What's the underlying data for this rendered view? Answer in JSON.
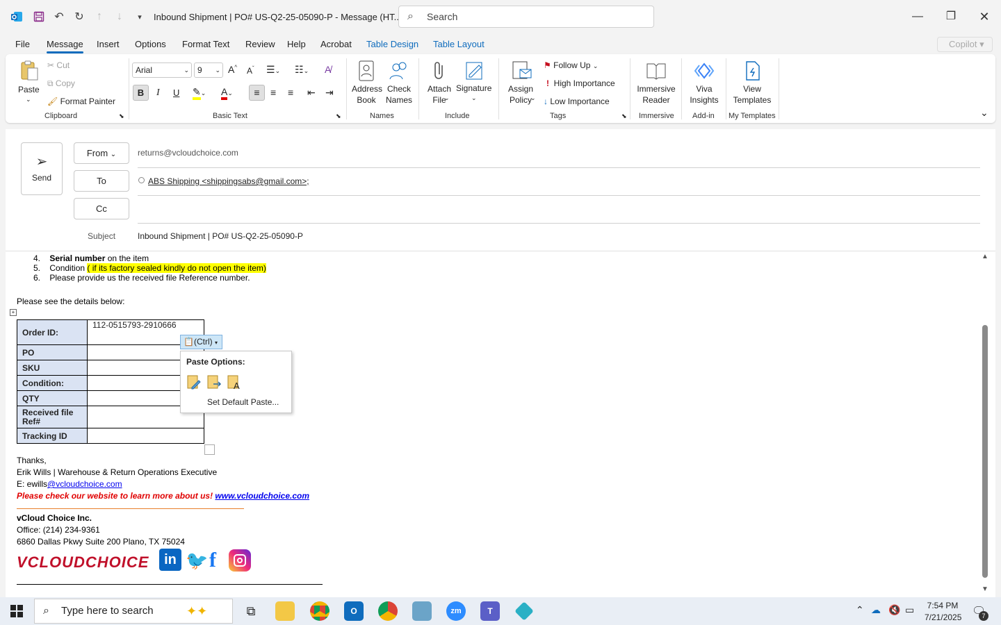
{
  "window": {
    "title": "Inbound Shipment | PO# US-Q2-25-05090-P  -  Message (HT...",
    "search_placeholder": "Search"
  },
  "tabs": [
    {
      "label": "File"
    },
    {
      "label": "Message"
    },
    {
      "label": "Insert"
    },
    {
      "label": "Options"
    },
    {
      "label": "Format Text"
    },
    {
      "label": "Review"
    },
    {
      "label": "Help"
    },
    {
      "label": "Acrobat"
    },
    {
      "label": "Table Design"
    },
    {
      "label": "Table Layout"
    }
  ],
  "copilot_label": "Copilot",
  "ribbon": {
    "clipboard": {
      "paste": "Paste",
      "cut": "Cut",
      "copy": "Copy",
      "format_painter": "Format Painter",
      "group": "Clipboard"
    },
    "basic_text": {
      "font": "Arial",
      "size": "9",
      "group": "Basic Text"
    },
    "names": {
      "address_book": "Address Book",
      "check_names": "Check Names",
      "group": "Names"
    },
    "include": {
      "attach_file": "Attach File",
      "signature": "Signature",
      "group": "Include"
    },
    "tags": {
      "assign_policy": "Assign Policy",
      "follow_up": "Follow Up",
      "high_importance": "High Importance",
      "low_importance": "Low Importance",
      "group": "Tags"
    },
    "immersive": {
      "reader": "Immersive Reader",
      "group": "Immersive"
    },
    "addin": {
      "viva": "Viva Insights",
      "group": "Add-in"
    },
    "templates": {
      "view": "View Templates",
      "group": "My Templates"
    }
  },
  "compose": {
    "send": "Send",
    "from_label": "From",
    "from_value": "returns@vcloudchoice.com",
    "to_label": "To",
    "to_value": "ABS Shipping <shippingsabs@gmail.com>;",
    "cc_label": "Cc",
    "subject_label": "Subject",
    "subject_value": "Inbound Shipment | PO# US-Q2-25-05090-P"
  },
  "body": {
    "list": [
      {
        "num": "4.",
        "bold": "Serial number",
        "rest": " on the item"
      },
      {
        "num": "5.",
        "text": "Condition ",
        "highlight": "( if its factory sealed kindly do not open the item)"
      },
      {
        "num": "6.",
        "text": "Please provide us the received file Reference number."
      }
    ],
    "intro": "Please see the details below:",
    "table": [
      {
        "label": "Order ID:",
        "value": "112-0515793-2910666"
      },
      {
        "label": "PO",
        "value": ""
      },
      {
        "label": "SKU",
        "value": ""
      },
      {
        "label": "Condition:",
        "value": ""
      },
      {
        "label": "QTY",
        "value": ""
      },
      {
        "label": "Received file Ref#",
        "value": ""
      },
      {
        "label": "Tracking ID",
        "value": ""
      }
    ],
    "thanks": "Thanks,",
    "signature_name": "Erik Wills | Warehouse & Return Operations Executive",
    "email_prefix": "E: ewills",
    "email_link": "@vcloudchoice.com",
    "website_text": "Please check our website to learn more about us! ",
    "website_link": "www.vcloudchoice.com",
    "company": "vCloud Choice Inc.",
    "office": "Office: (214) 234-9361",
    "address": "6860 Dallas Pkwy Suite 200 Plano, TX 75024",
    "logo_text": "VCLOUDCHOICE"
  },
  "paste_popup": {
    "ctrl_label": "(Ctrl)",
    "title": "Paste Options:",
    "set_default": "Set Default Paste..."
  },
  "taskbar": {
    "search_placeholder": "Type here to search",
    "time": "7:54 PM",
    "date": "7/21/2025",
    "notification_count": "7"
  }
}
